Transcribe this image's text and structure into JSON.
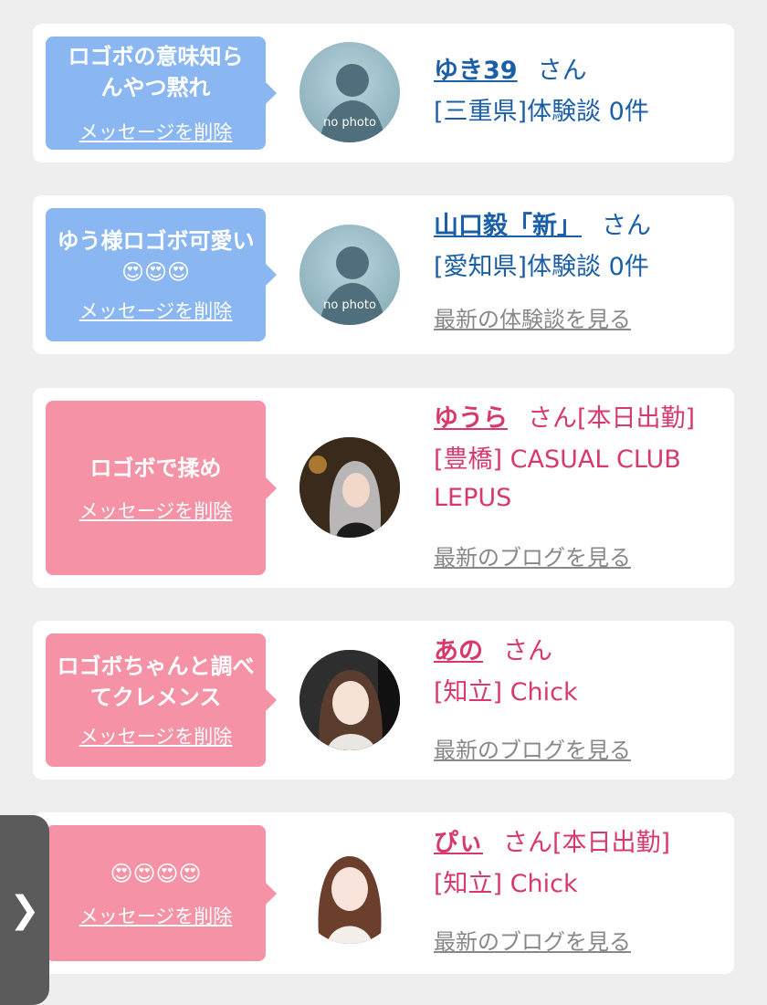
{
  "messages": [
    {
      "text": "ロゴボの意味知らんやつ黙れ",
      "emoji": "",
      "delete_label": "メッセージを削除",
      "name": "ゆき39",
      "san": "さん",
      "detail": "[三重県]体験談 0件",
      "latest": "",
      "avatar_text": "no photo"
    },
    {
      "text": "ゆう様ロゴボ可愛い",
      "emoji": "😍😍😍",
      "delete_label": "メッセージを削除",
      "name": "山口毅「新」",
      "san": "さん",
      "detail": "[愛知県]体験談 0件",
      "latest": "最新の体験談を見る",
      "avatar_text": "no photo"
    },
    {
      "text": "ロゴボで揉め",
      "emoji": "",
      "delete_label": "メッセージを削除",
      "name": "ゆうら",
      "san": "さん[本日出勤]",
      "detail": "[豊橋] CASUAL CLUB LEPUS",
      "latest": "最新のブログを見る",
      "avatar_text": ""
    },
    {
      "text": "ロゴボちゃんと調べてクレメンス",
      "emoji": "",
      "delete_label": "メッセージを削除",
      "name": "あの",
      "san": "さん",
      "detail": "[知立] Chick",
      "latest": "最新のブログを見る",
      "avatar_text": ""
    },
    {
      "text": "",
      "emoji": "😍😍😍😍",
      "delete_label": "メッセージを削除",
      "name": "ぴぃ",
      "san": "さん[本日出勤]",
      "detail": "[知立] Chick",
      "latest": "最新のブログを見る",
      "avatar_text": ""
    }
  ],
  "side_tab": {
    "icon": "chevron-right-icon",
    "glyph": "❯"
  },
  "colors": {
    "blue_bubble": "#8ab7f2",
    "pink_bubble": "#f592a5",
    "blue_text": "#1a5fa8",
    "pink_text": "#d9396a"
  }
}
